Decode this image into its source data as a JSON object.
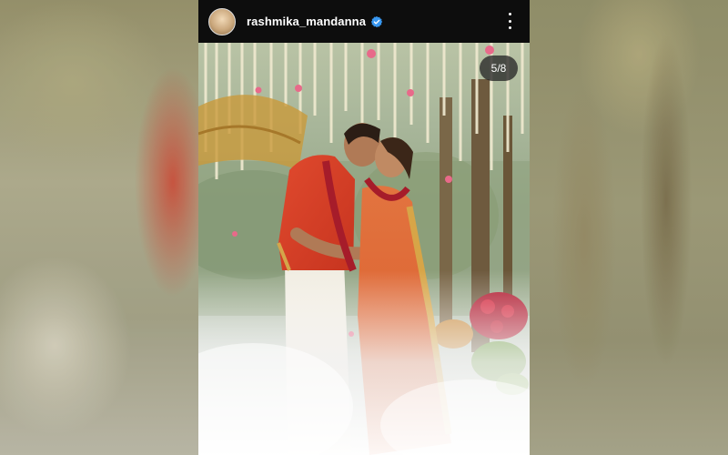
{
  "post": {
    "username": "rashmika_mandanna",
    "counter": "5/8",
    "icons": {
      "avatar": "profile-avatar",
      "verified": "verified-badge-icon",
      "more": "more-options-icon"
    }
  },
  "colors": {
    "verified_blue": "#3897f0",
    "header_bg": "#0d0d0d"
  }
}
